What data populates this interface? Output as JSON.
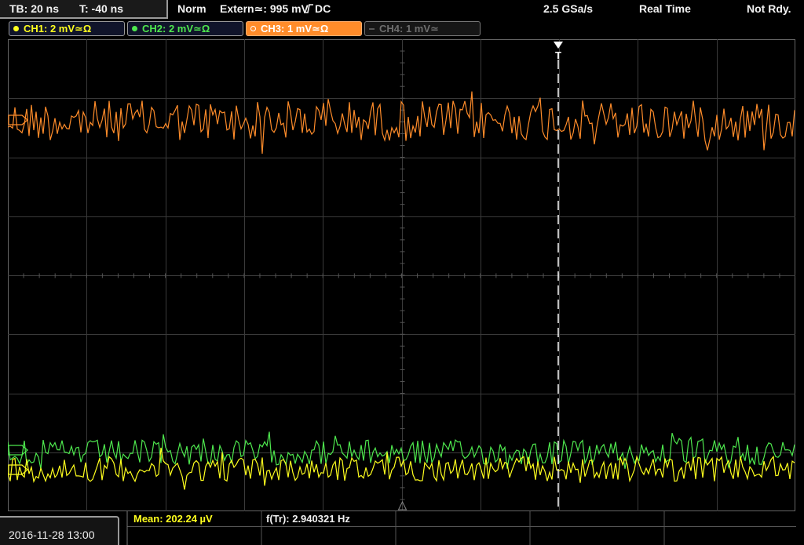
{
  "topbar": {
    "timebase": "TB: 20 ns",
    "trigger_time": "T: -40 ns",
    "acq_mode": "Norm",
    "trigger_source": "Extern≃: 995 mV",
    "trigger_coupling": "DC",
    "sample_rate": "2.5 GSa/s",
    "realtime": "Real Time",
    "status": "Not Rdy."
  },
  "channels": [
    {
      "label": "CH1: 2 mV≃Ω",
      "color": "#ffff1e",
      "active": true
    },
    {
      "label": "CH2: 2 mV≃Ω",
      "color": "#4ee84e",
      "active": true
    },
    {
      "label": "CH3: 1 mV≃Ω",
      "color": "#ff8c2a",
      "active": true,
      "selected": true
    },
    {
      "label": "CH4: 1 mV≃",
      "color": "#6e6e6e",
      "active": false
    }
  ],
  "markers": {
    "trigger_marker": "T"
  },
  "footer": {
    "datetime": "2016-11-28 13:00",
    "mean": "Mean: 202.24 µV",
    "freq": "f(Tr): 2.940321 Hz"
  },
  "colors": {
    "ch1": "#ffff1e",
    "ch2": "#4ee84e",
    "ch3": "#ff8c2a",
    "grid": "#3a3a3a",
    "cursor": "#ffffff"
  }
}
